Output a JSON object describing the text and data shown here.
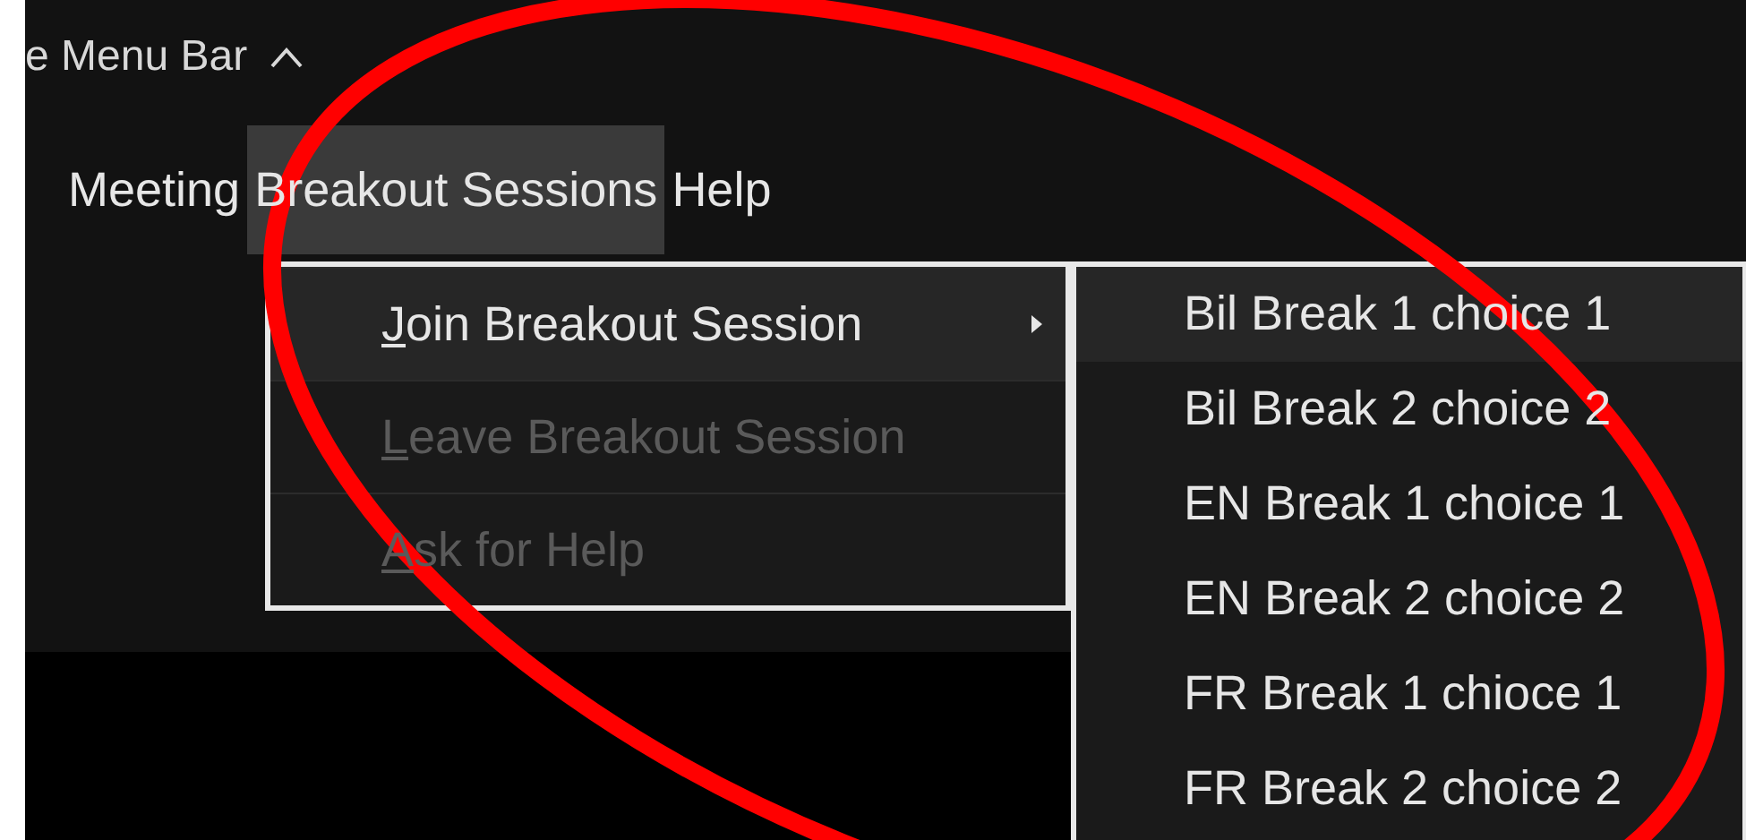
{
  "toolbar": {
    "label": "e Menu Bar"
  },
  "menu_bar": [
    {
      "label": "Meeting",
      "selected": false
    },
    {
      "label": "Breakout Sessions",
      "selected": true
    },
    {
      "label": "Help",
      "selected": false
    }
  ],
  "dropdown": [
    {
      "label": "Join Breakout Session",
      "selected": true,
      "disabled": false,
      "submenu": true
    },
    {
      "label": "Leave Breakout Session",
      "selected": false,
      "disabled": true,
      "submenu": false
    },
    {
      "label": "Ask for Help",
      "selected": false,
      "disabled": true,
      "submenu": false
    }
  ],
  "submenu": [
    {
      "label": "Bil Break 1 choice 1",
      "selected": true
    },
    {
      "label": "Bil Break 2 choice 2",
      "selected": false
    },
    {
      "label": "EN Break 1 choice 1",
      "selected": false
    },
    {
      "label": "EN Break 2 choice 2",
      "selected": false
    },
    {
      "label": "FR Break 1 chioce 1",
      "selected": false
    },
    {
      "label": "FR Break 2 choice 2",
      "selected": false
    }
  ],
  "annotation": {
    "kind": "ellipse"
  }
}
